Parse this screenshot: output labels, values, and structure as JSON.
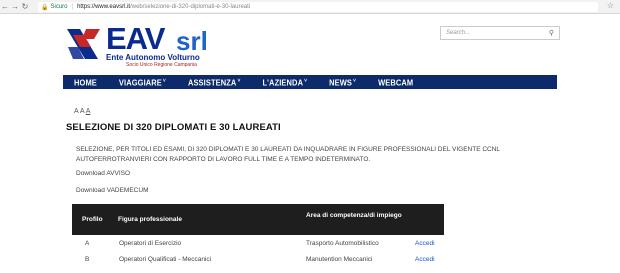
{
  "browser": {
    "secure_label": "Sicuro",
    "url_host": "https://www.eavsrl.it",
    "url_path": "/web/selezione-di-320-diplomati-e-30-laureati"
  },
  "header": {
    "logo_main": "EAV",
    "logo_suffix": "srl",
    "logo_subtitle": "Ente Autonomo Volturno",
    "logo_tagline": "Socio Unico Regione Campania",
    "search_placeholder": "Search..."
  },
  "nav": {
    "items": [
      {
        "label": "HOME",
        "has_caret": false
      },
      {
        "label": "VIAGGIARE",
        "has_caret": true
      },
      {
        "label": "ASSISTENZA",
        "has_caret": true
      },
      {
        "label": "L'AZIENDA",
        "has_caret": true
      },
      {
        "label": "NEWS",
        "has_caret": true
      },
      {
        "label": "WEBCAM",
        "has_caret": false
      }
    ],
    "caret": "˅"
  },
  "content": {
    "font_controls": "A A",
    "font_controls_large": "A",
    "title": "SELEZIONE DI 320 DIPLOMATI E 30 LAUREATI",
    "description": "SELEZIONE, PER TITOLI ED ESAMI, DI 320 DIPLOMATI E 30 LAUREATI DA INQUADRARE IN FIGURE PROFESSIONALI DEL VIGENTE CCNL AUTOFERROTRANVIERI CON RAPPORTO DI LAVORO FULL TIME E A TEMPO INDETERMINATO.",
    "download_1": "Download AVVISO",
    "download_2": "Download VADEMECUM"
  },
  "table": {
    "headers": {
      "profilo": "Profilo",
      "figura": "Figura professionale",
      "area": "Area di competenza/di impiego"
    },
    "rows": [
      {
        "profilo": "A",
        "figura": "Operatori di Esercizio",
        "area": "Trasporto Automobilistico",
        "link": "Accedi"
      },
      {
        "profilo": "B",
        "figura": "Operatori Qualificati - Meccanici",
        "area": "Manutention Meccanici",
        "link": "Accedi"
      }
    ]
  },
  "colors": {
    "nav_bg": "#0d2a6b",
    "logo_blue": "#0b2a8f",
    "link": "#1a55c9",
    "table_header": "#1e1e1e"
  }
}
